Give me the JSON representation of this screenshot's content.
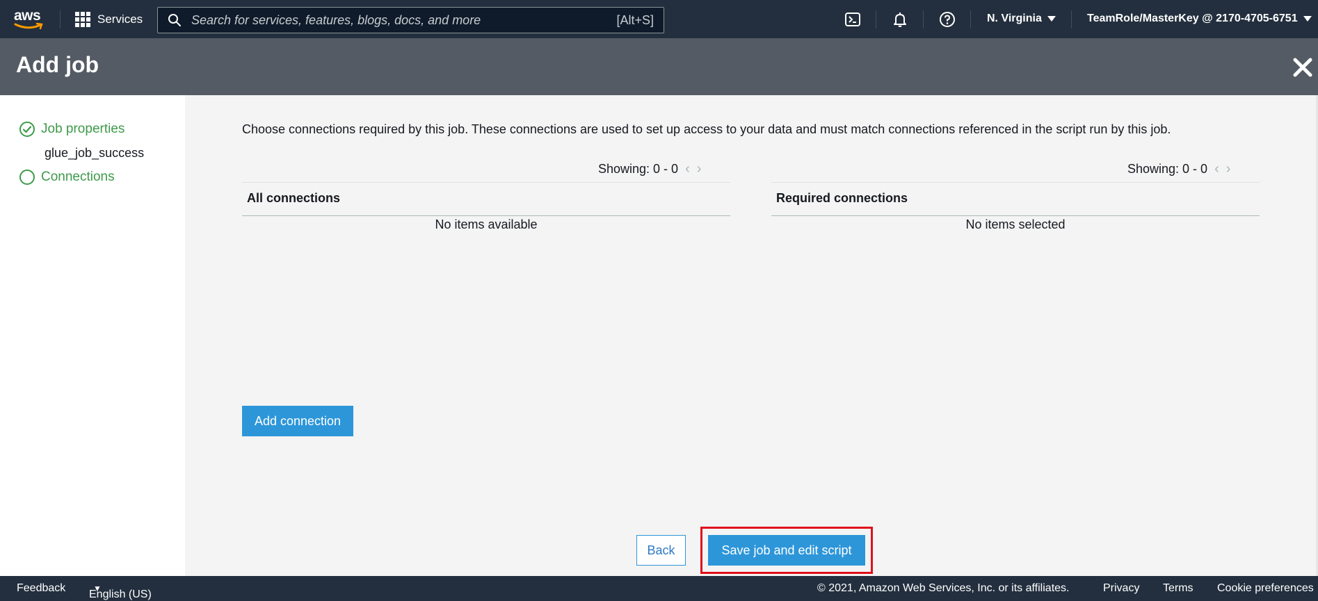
{
  "topnav": {
    "logo_text": "aws",
    "services_label": "Services",
    "search_placeholder": "Search for services, features, blogs, docs, and more",
    "search_shortcut": "[Alt+S]",
    "region": "N. Virginia",
    "account": "TeamRole/MasterKey @ 2170-4705-6751"
  },
  "header": {
    "title": "Add job"
  },
  "sidebar": {
    "steps": [
      {
        "label": "Job properties",
        "status": "complete",
        "sub": "glue_job_success"
      },
      {
        "label": "Connections",
        "status": "current"
      }
    ]
  },
  "main": {
    "description": "Choose connections required by this job. These connections are used to set up access to your data and must match connections referenced in the script run by this job.",
    "left_panel": {
      "pager": "Showing: 0 - 0",
      "title": "All connections",
      "empty": "No items available"
    },
    "right_panel": {
      "pager": "Showing: 0 - 0",
      "title": "Required connections",
      "empty": "No items selected"
    },
    "add_connection_label": "Add connection",
    "back_label": "Back",
    "save_label": "Save job and edit script"
  },
  "footer": {
    "feedback": "Feedback",
    "language": "English (US)",
    "copyright": "© 2021, Amazon Web Services, Inc. or its affiliates.",
    "privacy": "Privacy",
    "terms": "Terms",
    "cookies": "Cookie preferences"
  },
  "colors": {
    "nav_bg": "#232f3e",
    "header_bg": "#545b64",
    "step_green": "#3d9a4a",
    "primary_blue": "#2d96d9",
    "highlight_red": "#e0101b"
  }
}
